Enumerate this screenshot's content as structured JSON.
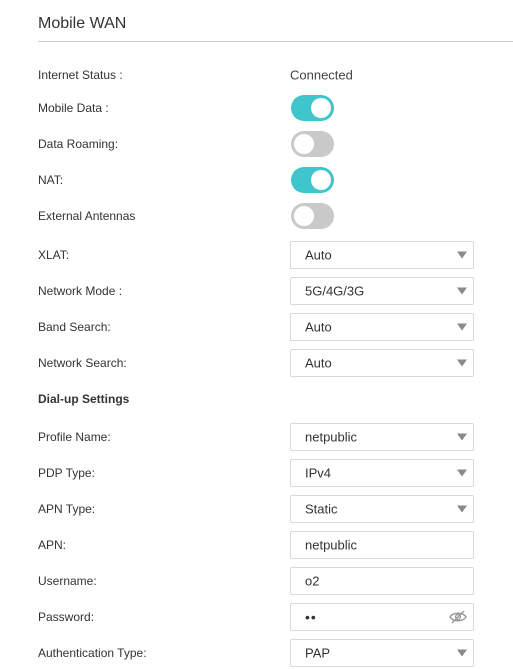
{
  "section": {
    "title": "Mobile WAN"
  },
  "status": {
    "internet_status_label": "Internet Status :",
    "internet_status_value": "Connected"
  },
  "toggles": {
    "mobile_data": {
      "label": "Mobile Data :",
      "on": true
    },
    "data_roaming": {
      "label": "Data Roaming:",
      "on": false
    },
    "nat": {
      "label": "NAT:",
      "on": true
    },
    "external_antennas": {
      "label": "External Antennas",
      "on": false
    }
  },
  "selects": {
    "xlat": {
      "label": "XLAT:",
      "value": "Auto"
    },
    "network_mode": {
      "label": "Network Mode :",
      "value": "5G/4G/3G"
    },
    "band_search": {
      "label": "Band Search:",
      "value": "Auto"
    },
    "network_search": {
      "label": "Network Search:",
      "value": "Auto"
    }
  },
  "dialup": {
    "heading": "Dial-up Settings",
    "profile_name": {
      "label": "Profile Name:",
      "value": "netpublic"
    },
    "pdp_type": {
      "label": "PDP Type:",
      "value": "IPv4"
    },
    "apn_type": {
      "label": "APN Type:",
      "value": "Static"
    },
    "apn": {
      "label": "APN:",
      "value": "netpublic"
    },
    "username": {
      "label": "Username:",
      "value": "o2"
    },
    "password": {
      "label": "Password:",
      "value": "••",
      "icon": "eye-slash-icon"
    },
    "auth_type": {
      "label": "Authentication Type:",
      "value": "PAP"
    }
  },
  "colors": {
    "toggle_on": "#3ec6cc",
    "toggle_off": "#c9c9c9"
  }
}
